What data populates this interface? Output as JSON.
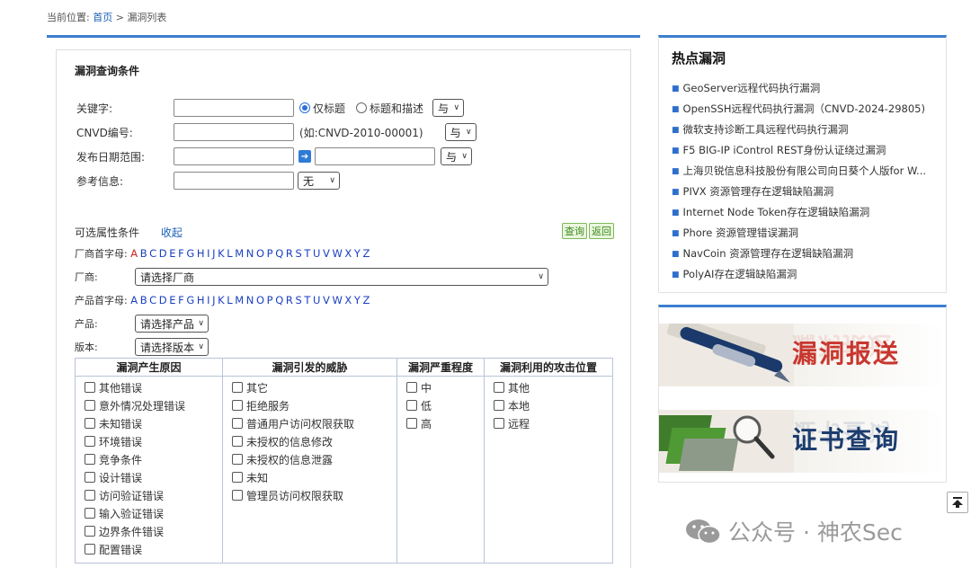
{
  "breadcrumb": {
    "prefix": "当前位置:",
    "home": "首页",
    "sep": ">",
    "current": "漏洞列表"
  },
  "query": {
    "title": "漏洞查询条件",
    "keyword": {
      "label": "关键字:",
      "value": "",
      "radio_title": "仅标题",
      "radio_both": "标题和描述",
      "logic": "与"
    },
    "cnvd": {
      "label": "CNVD编号:",
      "value": "",
      "hint": "(如:CNVD-2010-00001)",
      "logic": "与"
    },
    "date": {
      "label": "发布日期范围:",
      "from": "",
      "to": "",
      "logic": "与"
    },
    "ref": {
      "label": "参考信息:",
      "value": "",
      "option": "无"
    },
    "optional_label": "可选属性条件",
    "collapse": "收起",
    "search_btn": "查询",
    "back_btn": "返回"
  },
  "letters": [
    "A",
    "B",
    "C",
    "D",
    "E",
    "F",
    "G",
    "H",
    "I",
    "J",
    "K",
    "L",
    "M",
    "N",
    "O",
    "P",
    "Q",
    "R",
    "S",
    "T",
    "U",
    "V",
    "W",
    "X",
    "Y",
    "Z"
  ],
  "vendor": {
    "letters_label": "厂商首字母:",
    "label": "厂商:",
    "placeholder": "请选择厂商"
  },
  "product": {
    "letters_label": "产品首字母:",
    "label": "产品:",
    "placeholder": "请选择产品"
  },
  "version": {
    "label": "版本:",
    "placeholder": "请选择版本"
  },
  "attr_table": {
    "headers": [
      "漏洞产生原因",
      "漏洞引发的威胁",
      "漏洞严重程度",
      "漏洞利用的攻击位置"
    ],
    "cause": [
      "其他错误",
      "意外情况处理错误",
      "未知错误",
      "环境错误",
      "竞争条件",
      "设计错误",
      "访问验证错误",
      "输入验证错误",
      "边界条件错误",
      "配置错误"
    ],
    "threat": [
      "其它",
      "拒绝服务",
      "普通用户访问权限获取",
      "未授权的信息修改",
      "未授权的信息泄露",
      "未知",
      "管理员访问权限获取"
    ],
    "severity": [
      "中",
      "低",
      "高"
    ],
    "position": [
      "其他",
      "本地",
      "远程"
    ]
  },
  "hot": {
    "title": "热点漏洞",
    "items": [
      "GeoServer远程代码执行漏洞",
      "OpenSSH远程代码执行漏洞（CNVD-2024-29805)",
      "微软支持诊断工具远程代码执行漏洞",
      "F5 BIG-IP iControl REST身份认证绕过漏洞",
      "上海贝锐信息科技股份有限公司向日葵个人版for W...",
      "PIVX 资源管理存在逻辑缺陷漏洞",
      "Internet Node Token存在逻辑缺陷漏洞",
      "Phore 资源管理错误漏洞",
      "NavCoin 资源管理存在逻辑缺陷漏洞",
      "PolyAI存在逻辑缺陷漏洞"
    ]
  },
  "banners": {
    "report": "漏洞报送",
    "cert": "证书查询"
  },
  "watermark": {
    "text": "公众号 · 神农Sec"
  },
  "colors": {
    "accent": "#3b7fd0",
    "link": "#1a5fb4",
    "letter": "#1a3fc0",
    "active_letter": "#d02020",
    "banner_red": "#c8372f",
    "banner_blue": "#1d3d6e"
  }
}
